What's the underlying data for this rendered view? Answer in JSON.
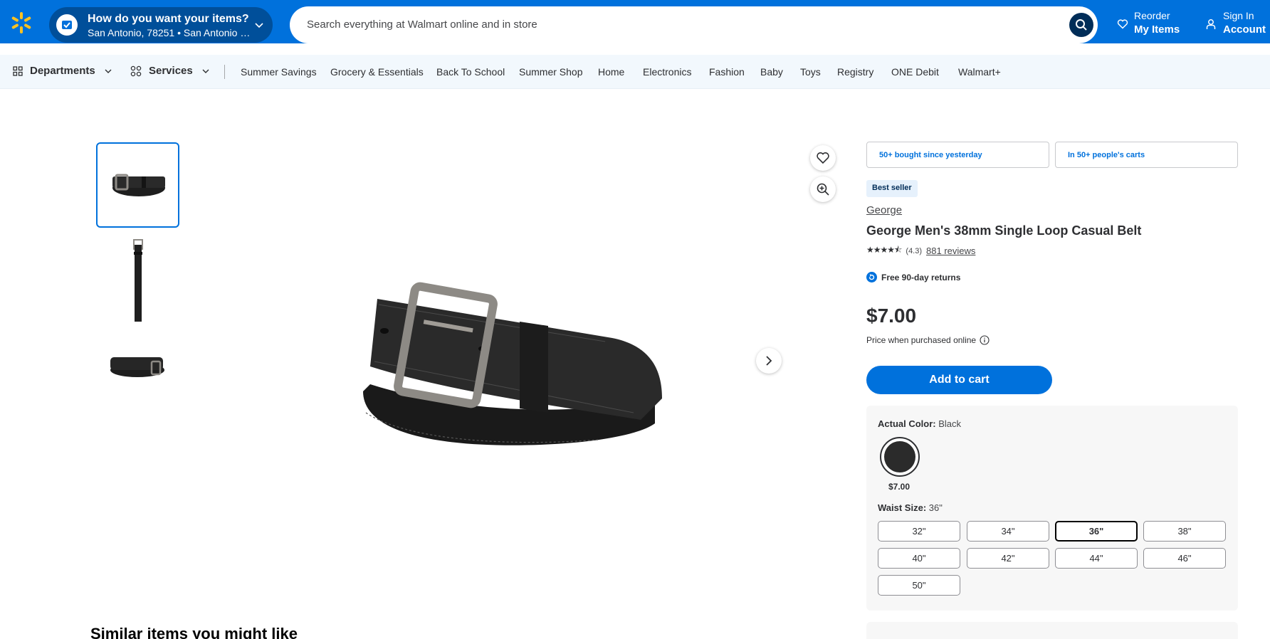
{
  "header": {
    "location_title": "How do you want your items?",
    "location_sub": "San Antonio, 78251 • San Antonio Su...",
    "search_placeholder": "Search everything at Walmart online and in store",
    "reorder_top": "Reorder",
    "reorder_bottom": "My Items",
    "signin_top": "Sign In",
    "signin_bottom": "Account"
  },
  "nav": {
    "departments": "Departments",
    "services": "Services",
    "links": [
      "Summer Savings",
      "Grocery & Essentials",
      "Back To School",
      "Summer Shop",
      "Home",
      "Electronics",
      "Fashion",
      "Baby",
      "Toys",
      "Registry",
      "ONE Debit",
      "Walmart+"
    ]
  },
  "product": {
    "social_proof": [
      "50+ bought since yesterday",
      "In 50+ people's carts"
    ],
    "badge": "Best seller",
    "brand": "George",
    "title": "George Men's 38mm Single Loop Casual Belt",
    "rating": 4.3,
    "stars": "★★★★⯪",
    "rating_text": "(4.3)",
    "reviews": "881 reviews",
    "returns": "Free 90-day returns",
    "price": "$7.00",
    "price_note": "Price when purchased online",
    "add_to_cart": "Add to cart"
  },
  "variants": {
    "color_label": "Actual Color:",
    "color_value": "Black",
    "swatch_color": "#2b2b2b",
    "swatch_price": "$7.00",
    "size_label": "Waist Size:",
    "size_value": "36\"",
    "sizes": [
      "32\"",
      "34\"",
      "36\"",
      "38\"",
      "40\"",
      "42\"",
      "44\"",
      "46\"",
      "50\""
    ],
    "selected_size": "36\""
  },
  "similar_title": "Similar items you might like",
  "colors": {
    "brand_blue": "#0071dc",
    "dark_blue": "#004f9a",
    "spark_yellow": "#ffc220"
  }
}
